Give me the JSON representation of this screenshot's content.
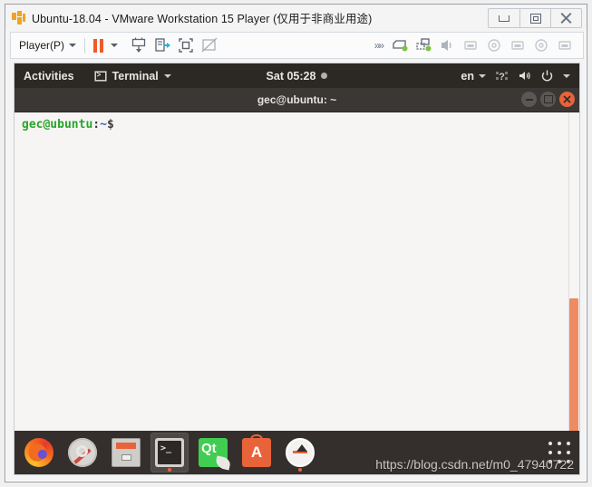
{
  "vmware": {
    "title": "Ubuntu-18.04 - VMware Workstation 15 Player (仅用于非商业用途)",
    "app_icon": "vmware-logo-icon",
    "window_controls": [
      {
        "name": "minimize-button",
        "icon": "minimize-icon"
      },
      {
        "name": "restore-button",
        "icon": "restore-icon"
      },
      {
        "name": "close-button",
        "icon": "close-icon"
      }
    ],
    "toolbar": {
      "player_menu_label": "Player(P)",
      "pause_icon": "pause-icon",
      "pause_dropdown_icon": "chevron-down-icon",
      "left_icons": [
        "send-ctrl-alt-del-icon",
        "manage-vm-icon",
        "full-screen-icon",
        "unity-mode-icon"
      ],
      "overflow_icon": "double-chevron-right-icon",
      "right_icons": [
        "hard-disk-icon",
        "network-adapter-icon",
        "sound-card-icon",
        "usb-device-1-icon",
        "cd-dvd-1-icon",
        "usb-device-2-icon",
        "cd-dvd-2-icon",
        "usb-device-3-icon"
      ]
    }
  },
  "guest": {
    "topbar": {
      "activities_label": "Activities",
      "window_menu_icon": "terminal-app-icon",
      "window_menu_label": "Terminal",
      "window_menu_caret": "chevron-down-icon",
      "clock": "Sat 05:28",
      "notification_dot": "notification-dot-icon",
      "language_label": "en",
      "language_caret": "chevron-down-icon",
      "status_icons": [
        "accessibility-icon",
        "volume-icon",
        "power-icon",
        "chevron-down-icon"
      ]
    },
    "terminal": {
      "title": "gec@ubuntu: ~",
      "window_controls": [
        {
          "name": "terminal-minimize-button",
          "icon": "minimize-icon"
        },
        {
          "name": "terminal-maximize-button",
          "icon": "maximize-icon"
        },
        {
          "name": "terminal-close-button",
          "icon": "close-icon"
        }
      ],
      "prompt": {
        "user_host": "gec@ubuntu",
        "separator": ":",
        "path": "~",
        "symbol": "$"
      },
      "scrollbar": {
        "name": "terminal-scrollbar",
        "thumb_color": "#ef8b62"
      }
    },
    "dock": {
      "items": [
        {
          "name": "dock-item-firefox",
          "label": "Firefox",
          "icon": "firefox-icon",
          "active": false,
          "running": false
        },
        {
          "name": "dock-item-tools",
          "label": "Settings Tools",
          "icon": "tools-icon",
          "active": false,
          "running": false
        },
        {
          "name": "dock-item-files",
          "label": "Files",
          "icon": "files-icon",
          "active": false,
          "running": false
        },
        {
          "name": "dock-item-terminal",
          "label": "Terminal",
          "icon": "terminal-icon",
          "active": true,
          "running": true
        },
        {
          "name": "dock-item-qtcreator",
          "label": "Qt Creator",
          "icon": "qt-creator-icon",
          "active": false,
          "running": false
        },
        {
          "name": "dock-item-ubuntu-software",
          "label": "Ubuntu Software",
          "icon": "ubuntu-software-icon",
          "active": false,
          "running": false
        },
        {
          "name": "dock-item-software-updater",
          "label": "Software Updater",
          "icon": "software-updater-icon",
          "active": false,
          "running": true
        }
      ],
      "show_apps_icon": "app-grid-icon"
    }
  },
  "watermark": "https://blog.csdn.net/m0_47940722",
  "colors": {
    "accent_orange": "#e8633a",
    "scrollbar_orange": "#ef8b62",
    "topbar_dark": "#2c2925",
    "dock_dark": "#342f2c",
    "terminal_bg": "#f6f5f4",
    "prompt_green": "#2aa52a",
    "prompt_blue": "#3f5fd0"
  }
}
